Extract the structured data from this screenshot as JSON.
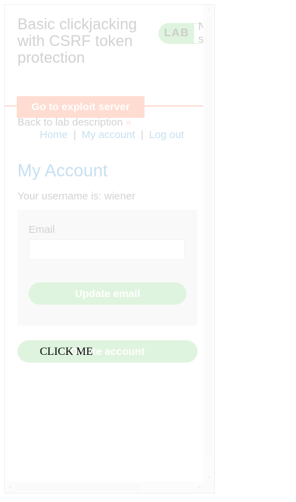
{
  "lab": {
    "title": "Basic clickjacking with CSRF token protection",
    "badge_label": "LAB",
    "badge_status": "Not solved",
    "exploit_button": "Go to exploit server",
    "back_link": "Back to lab description",
    "back_arrow": "»"
  },
  "nav": {
    "home": "Home",
    "my_account": "My account",
    "log_out": "Log out",
    "separator": "|"
  },
  "account": {
    "heading": "My Account",
    "username_line": "Your username is: wiener",
    "email_label": "Email",
    "email_value": "",
    "update_button": "Update email",
    "delete_button": "Delete account"
  },
  "decoy": {
    "text": "CLICK ME"
  },
  "colors": {
    "accent_green": "#70d16d",
    "exploit_orange": "#ff6633",
    "link_blue": "#0071bc",
    "iframe_opacity": "0.22"
  },
  "icons": {
    "scroll_up": "▲",
    "scroll_down": "▼",
    "scroll_left": "◀",
    "scroll_right": "▶"
  }
}
